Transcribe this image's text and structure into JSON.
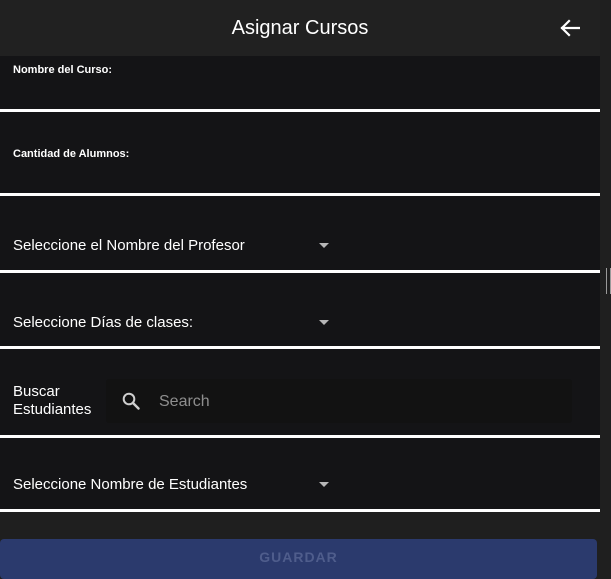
{
  "header": {
    "title": "Asignar Cursos",
    "back_icon": "arrow-left-icon"
  },
  "form": {
    "course_name_label": "Nombre del Curso:",
    "student_count_label": "Cantidad de Alumnos:",
    "professor_select": "Seleccione el Nombre del Profesor",
    "days_select": "Seleccione Días de clases:",
    "search_label_line1": "Buscar",
    "search_label_line2": "Estudiantes",
    "search_placeholder": "Search",
    "students_select": "Seleccione Nombre de Estudiantes",
    "save_label": "GUARDAR"
  },
  "colors": {
    "background": "#1f1f1f",
    "appbar": "#212121",
    "field": "#141416",
    "underline": "#ffffff",
    "button": "#2b3a6d"
  }
}
